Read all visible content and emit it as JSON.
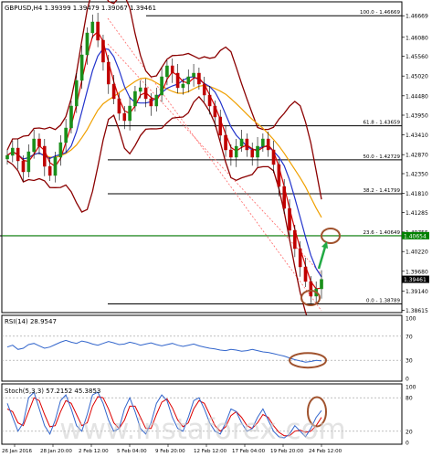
{
  "header": "GBPUSD,H4  1.39399 1.39479 1.39067 1.39461",
  "rsi_label": "RSI(14) 28.9547",
  "stoch_label": "Stoch(5,3,3) 57.2152 45.3853",
  "watermark": "www.instaforex.com",
  "colors": {
    "bull": "#1a8f1a",
    "bear": "#c00000",
    "bb": "#8b0000",
    "ma_fast": "#d40000",
    "ma_mid": "#2233cc",
    "ma_slow": "#f0a000",
    "fib": "#000000",
    "green_line": "#008000",
    "circle": "#a0522d",
    "arrow": "#22aa44",
    "indicator_blue": "#3366cc",
    "stoch_red": "#dd0000",
    "trend_red": "#ff6666"
  },
  "chart_data": [
    {
      "type": "candlestick",
      "title": "GBPUSD,H4",
      "ohlc_last": {
        "open": 1.39399,
        "high": 1.39479,
        "low": 1.39067,
        "close": 1.39461
      },
      "ylim": [
        1.3855,
        1.4705
      ],
      "y_ticks": [
        "1.46669",
        "1.46080",
        "1.45560",
        "1.45020",
        "1.44480",
        "1.43950",
        "1.43410",
        "1.42870",
        "1.42350",
        "1.41810",
        "1.41285",
        "1.40755",
        "1.40220",
        "1.39680",
        "1.39140",
        "1.38615"
      ],
      "x_ticks": [
        "26 Jan 2016",
        "28 Jan 20:00",
        "2 Feb 12:00",
        "5 Feb 04:00",
        "9 Feb 20:00",
        "12 Feb 12:00",
        "17 Feb 04:00",
        "19 Feb 20:00",
        "24 Feb 12:00"
      ],
      "current_price_tag": "1.39461",
      "green_level_tag": "1.40654",
      "fibonacci": [
        {
          "label": "100.0 - 1.46669",
          "price": 1.46669
        },
        {
          "label": "61.8 - 1.43659",
          "price": 1.43659
        },
        {
          "label": "50.0 - 1.42729",
          "price": 1.42729
        },
        {
          "label": "38.2 - 1.41799",
          "price": 1.41799
        },
        {
          "label": "23.6 - 1.40649",
          "price": 1.40649
        },
        {
          "label": "0.0 - 1.38789",
          "price": 1.38789
        }
      ],
      "close_path": [
        1.4285,
        1.4305,
        1.427,
        1.424,
        1.4295,
        1.433,
        1.431,
        1.4255,
        1.423,
        1.428,
        1.432,
        1.436,
        1.442,
        1.449,
        1.456,
        1.462,
        1.465,
        1.46,
        1.454,
        1.448,
        1.444,
        1.44,
        1.438,
        1.442,
        1.446,
        1.447,
        1.444,
        1.442,
        1.445,
        1.45,
        1.453,
        1.451,
        1.447,
        1.448,
        1.45,
        1.451,
        1.448,
        1.445,
        1.442,
        1.439,
        1.434,
        1.43,
        1.428,
        1.431,
        1.433,
        1.43,
        1.428,
        1.431,
        1.433,
        1.43,
        1.426,
        1.42,
        1.414,
        1.408,
        1.403,
        1.398,
        1.394,
        1.39,
        1.392,
        1.3946
      ]
    },
    {
      "type": "line",
      "title": "RSI(14) 28.9547",
      "ylim": [
        0,
        100
      ],
      "y_ticks": [
        "100",
        "70",
        "30",
        "0"
      ],
      "values": [
        52,
        55,
        48,
        50,
        56,
        58,
        54,
        50,
        52,
        56,
        60,
        63,
        60,
        58,
        62,
        60,
        57,
        55,
        58,
        61,
        59,
        56,
        57,
        60,
        58,
        55,
        57,
        59,
        56,
        54,
        56,
        58,
        55,
        53,
        55,
        57,
        54,
        52,
        50,
        49,
        47,
        46,
        48,
        47,
        45,
        46,
        48,
        46,
        44,
        43,
        41,
        39,
        37,
        34,
        31,
        29,
        27,
        28,
        30,
        29
      ]
    },
    {
      "type": "line",
      "title": "Stoch(5,3,3) 57.2152 45.3853",
      "ylim": [
        0,
        100
      ],
      "y_ticks": [
        "100",
        "80",
        "20",
        "0"
      ],
      "series": [
        {
          "name": "main",
          "values": [
            70,
            45,
            20,
            35,
            80,
            90,
            60,
            30,
            15,
            40,
            75,
            85,
            60,
            30,
            20,
            50,
            85,
            90,
            70,
            40,
            20,
            25,
            60,
            80,
            55,
            25,
            15,
            35,
            70,
            85,
            75,
            45,
            25,
            20,
            45,
            75,
            80,
            60,
            35,
            20,
            15,
            35,
            60,
            55,
            35,
            20,
            25,
            45,
            60,
            40,
            20,
            10,
            8,
            15,
            30,
            20,
            10,
            25,
            45,
            57
          ]
        },
        {
          "name": "signal",
          "values": [
            60,
            55,
            35,
            30,
            55,
            80,
            75,
            50,
            28,
            30,
            55,
            75,
            70,
            50,
            30,
            35,
            65,
            82,
            80,
            60,
            35,
            25,
            40,
            65,
            65,
            45,
            25,
            25,
            50,
            72,
            78,
            62,
            40,
            28,
            35,
            60,
            75,
            70,
            50,
            30,
            20,
            28,
            48,
            55,
            45,
            30,
            25,
            35,
            50,
            45,
            30,
            18,
            12,
            12,
            20,
            22,
            18,
            20,
            30,
            45
          ]
        }
      ]
    }
  ]
}
